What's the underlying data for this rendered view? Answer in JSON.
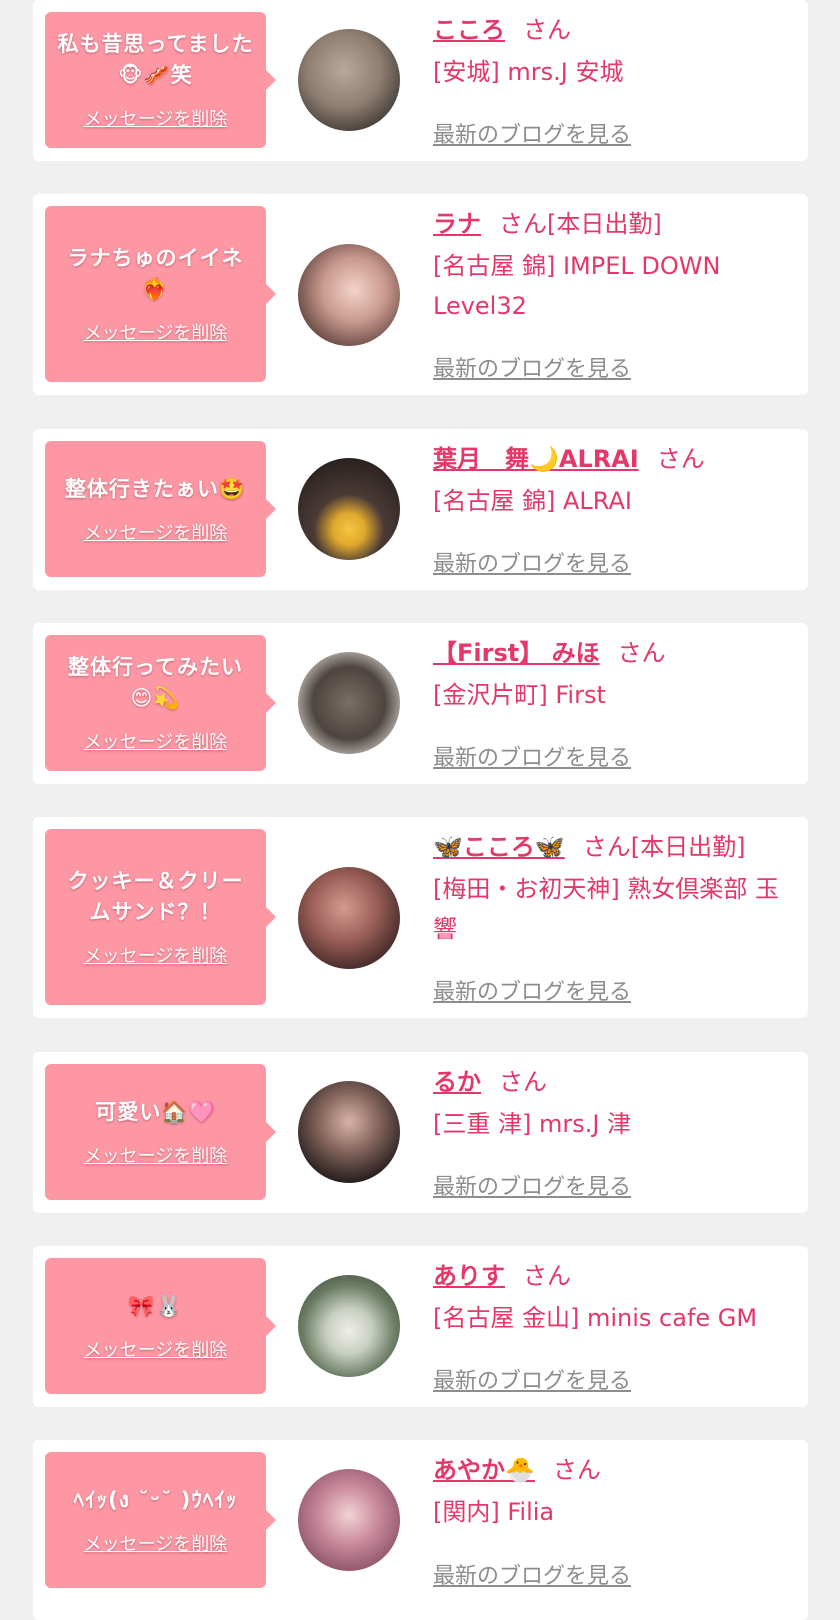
{
  "delete_label": "メッセージを削除",
  "blog_label": "最新のブログを見る",
  "cards": [
    {
      "message": "私も昔思ってました🐵🥓笑",
      "name": "こころ",
      "suffix": "さん",
      "shop": "[安城] mrs.J 安城"
    },
    {
      "message": "ラナちゅのイイネ❤️‍🔥",
      "name": "ラナ",
      "suffix": "さん[本日出勤]",
      "shop": "[名古屋 錦] IMPEL DOWN Level32"
    },
    {
      "message": "整体行きたぁい🤩",
      "name": "葉月　舞🌙ALRAI",
      "suffix": "さん",
      "shop": "[名古屋 錦] ALRAI"
    },
    {
      "message": "整体行ってみたい😊💫",
      "name": "【First】 みほ",
      "suffix": "さん",
      "shop": "[金沢片町] First"
    },
    {
      "message": "クッキー＆クリームサンド？！",
      "name": "🦋こころ🦋",
      "suffix": "さん[本日出勤]",
      "shop": "[梅田・お初天神] 熟女倶楽部 玉響"
    },
    {
      "message": "可愛い🏠🩷",
      "name": "るか",
      "suffix": "さん",
      "shop": "[三重 津] mrs.J 津"
    },
    {
      "message": "🎀🐰",
      "name": "ありす",
      "suffix": "さん",
      "shop": "[名古屋 金山] minis cafe GM"
    },
    {
      "message": "ﾍｲｯ(ง ˘ᵕ˘ )ｳﾍｲｯ",
      "name": "あやか🐣",
      "suffix": "さん",
      "shop": "[関内] Filia"
    }
  ],
  "colors": {
    "bubble": "#fd97a4",
    "accent": "#e4376a",
    "muted": "#8d8d8d",
    "background": "#f0f0f0"
  }
}
